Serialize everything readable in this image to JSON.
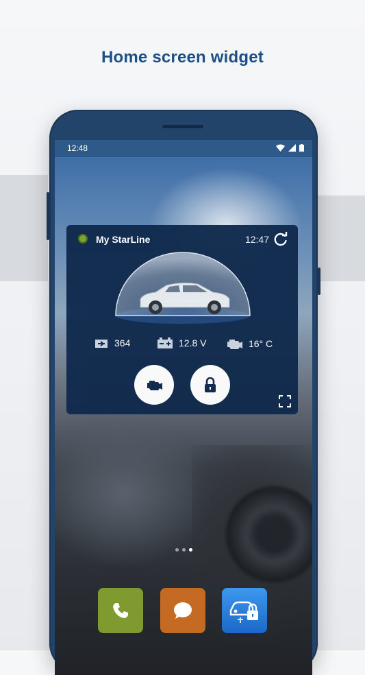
{
  "heading": "Home screen widget",
  "status_bar": {
    "time": "12:48"
  },
  "widget": {
    "title": "My StarLine",
    "time": "12:47",
    "stats": [
      {
        "icon": "odometer-icon",
        "value": "364"
      },
      {
        "icon": "battery-icon",
        "value": "12.8 V"
      },
      {
        "icon": "engine-icon",
        "value": "16° C"
      }
    ],
    "buttons": [
      {
        "icon": "engine-start-icon"
      },
      {
        "icon": "lock-icon"
      }
    ],
    "status_color": "#7da62f"
  },
  "home": {
    "page_count": 3,
    "active_page": 3,
    "dock": [
      {
        "app": "phone",
        "icon": "phone-icon",
        "color": "#7f9a2e"
      },
      {
        "app": "messages",
        "icon": "chat-icon",
        "color": "#c46a22"
      },
      {
        "app": "starline",
        "icon": "car-lock-icon",
        "color": "#2a7fd8"
      }
    ]
  },
  "colors": {
    "accent": "#1d4f86",
    "widget_bg": "#102a4d"
  }
}
